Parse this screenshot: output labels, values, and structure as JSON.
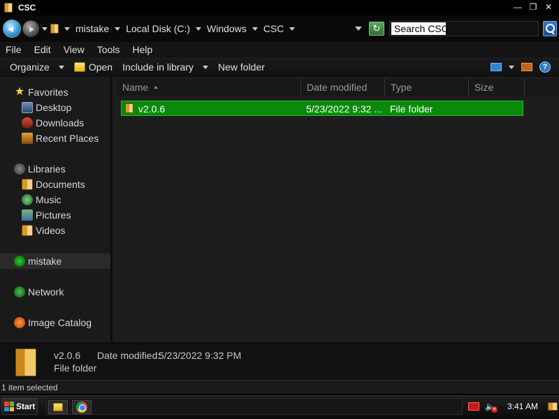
{
  "window": {
    "title": "CSC"
  },
  "title_buttons": {
    "minimize": "—",
    "restore": "❐",
    "close": "✕"
  },
  "address": {
    "crumbs": [
      "mistake",
      "Local Disk (C:)",
      "Windows",
      "CSC"
    ],
    "refresh_glyph": "↻"
  },
  "search": {
    "value": "Search CSC"
  },
  "menu": [
    "File",
    "Edit",
    "View",
    "Tools",
    "Help"
  ],
  "toolbar": {
    "organize": "Organize",
    "open": "Open",
    "include_in_library": "Include in library",
    "new_folder": "New folder",
    "help_glyph": "?"
  },
  "nav": {
    "favorites": "Favorites",
    "desktop": "Desktop",
    "downloads": "Downloads",
    "recent_places": "Recent Places",
    "libraries": "Libraries",
    "documents": "Documents",
    "music": "Music",
    "pictures": "Pictures",
    "videos": "Videos",
    "homegroup": "mistake",
    "network": "Network",
    "image_catalog": "Image Catalog"
  },
  "columns": {
    "name": "Name",
    "date_modified": "Date modified",
    "type": "Type",
    "size": "Size"
  },
  "files": [
    {
      "name": "v2.0.6",
      "date_modified": "5/23/2022 9:32 ...",
      "type": "File folder",
      "size": ""
    }
  ],
  "details": {
    "name": "v2.0.6",
    "modified_label": "Date modified:",
    "modified_value": "5/23/2022 9:32 PM",
    "type": "File folder"
  },
  "status": {
    "text": "1 item selected"
  },
  "taskbar": {
    "start_label": "Start",
    "clock": "3:41 AM"
  },
  "colors": {
    "selection": "#0a8a0a",
    "background": "#1d1d1d",
    "accent_blue": "#2d86d4"
  }
}
